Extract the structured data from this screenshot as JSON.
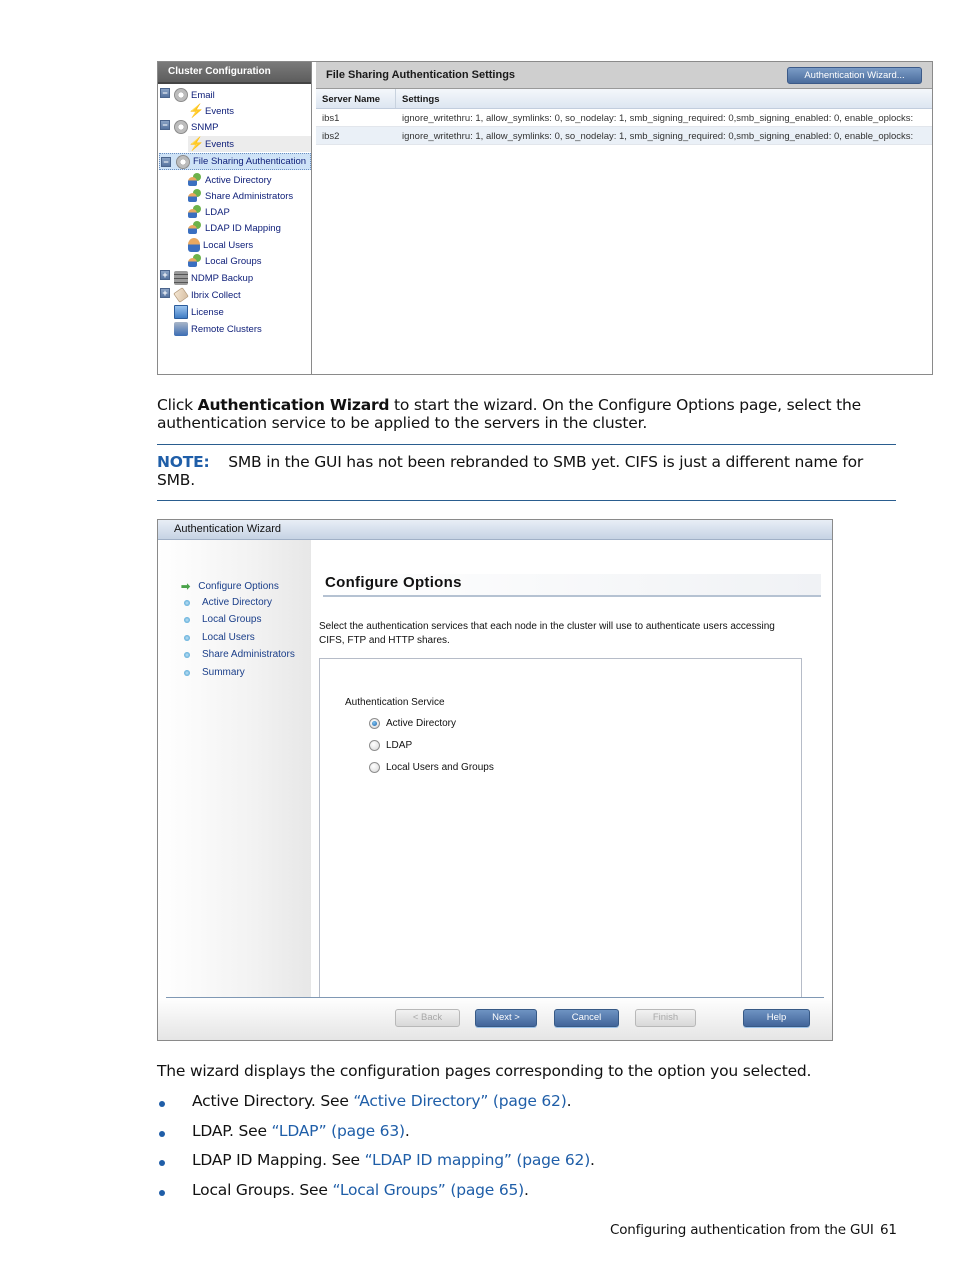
{
  "cluster_config": {
    "tree_title": "Cluster Configuration",
    "tree_items": [
      {
        "label": "Email",
        "icon": "gear-icon",
        "expander": "−"
      },
      {
        "label": "Events",
        "icon": "lightning-icon"
      },
      {
        "label": "SNMP",
        "icon": "gear-icon",
        "expander": "−"
      },
      {
        "label": "Events",
        "icon": "lightning-icon"
      },
      {
        "label": "File Sharing Authentication",
        "icon": "gear-icon",
        "expander": "−",
        "selected": true
      },
      {
        "label": "Active Directory",
        "icon": "users-icon"
      },
      {
        "label": "Share Administrators",
        "icon": "users-icon"
      },
      {
        "label": "LDAP",
        "icon": "users-icon"
      },
      {
        "label": "LDAP ID Mapping",
        "icon": "users-icon"
      },
      {
        "label": "Local Users",
        "icon": "user-icon"
      },
      {
        "label": "Local Groups",
        "icon": "users-icon"
      },
      {
        "label": "NDMP Backup",
        "icon": "server-icon",
        "expander": "+"
      },
      {
        "label": "Ibrix Collect",
        "icon": "tag-icon",
        "expander": "+"
      },
      {
        "label": "License",
        "icon": "document-icon"
      },
      {
        "label": "Remote Clusters",
        "icon": "cluster-icon"
      }
    ],
    "panel_title": "File Sharing Authentication Settings",
    "wizard_button": "Authentication Wizard...",
    "columns": [
      "Server Name",
      "Settings"
    ],
    "rows": [
      [
        "ibs1",
        "ignore_writethru: 1, allow_symlinks: 0, so_nodelay: 1, smb_signing_required: 0,smb_signing_enabled: 0, enable_oplocks:"
      ],
      [
        "ibs2",
        "ignore_writethru: 1, allow_symlinks: 0, so_nodelay: 1, smb_signing_required: 0,smb_signing_enabled: 0, enable_oplocks:"
      ]
    ]
  },
  "text": {
    "intro_pre": "Click ",
    "intro_bold": "Authentication Wizard",
    "intro_post": " to start the wizard. On the Configure Options page, select the",
    "intro_line2": "authentication service to be applied to the servers in the cluster.",
    "note_label": "NOTE:",
    "note_line1": "SMB in the GUI has not been rebranded to SMB yet. CIFS is just a different name for",
    "note_line2": "SMB.",
    "after_wizard": "The wizard displays the configuration pages corresponding to the option you selected."
  },
  "wizard": {
    "title": "Authentication Wizard",
    "steps": [
      {
        "label": "Configure Options",
        "current": true
      },
      {
        "label": "Active Directory"
      },
      {
        "label": "Local Groups"
      },
      {
        "label": "Local Users"
      },
      {
        "label": "Share Administrators"
      },
      {
        "label": "Summary"
      }
    ],
    "heading": "Configure Options",
    "description_line1": "Select the authentication services that each node in the cluster will use to authenticate users accessing",
    "description_line2": "CIFS, FTP and HTTP shares.",
    "service_label": "Authentication Service",
    "options": [
      {
        "label": "Active Directory",
        "selected": true
      },
      {
        "label": "LDAP",
        "selected": false
      },
      {
        "label": "Local Users and Groups",
        "selected": false
      }
    ],
    "buttons": {
      "back": "< Back",
      "next": "Next >",
      "cancel": "Cancel",
      "finish": "Finish",
      "help": "Help"
    }
  },
  "bullets": [
    {
      "pre": "Active Directory. See ",
      "link": "“Active Directory” (page 62)",
      "post": "."
    },
    {
      "pre": "LDAP. See ",
      "link": "“LDAP” (page 63)",
      "post": "."
    },
    {
      "pre": "LDAP ID Mapping. See ",
      "link": "“LDAP ID mapping” (page 62)",
      "post": "."
    },
    {
      "pre": "Local Groups. See ",
      "link": "“Local Groups” (page 65)",
      "post": "."
    }
  ],
  "footer": {
    "section": "Configuring authentication from the GUI",
    "page_number": "61"
  },
  "colors": {
    "link_blue": "#1f5ea8",
    "rule_blue": "#2a5d8f"
  }
}
